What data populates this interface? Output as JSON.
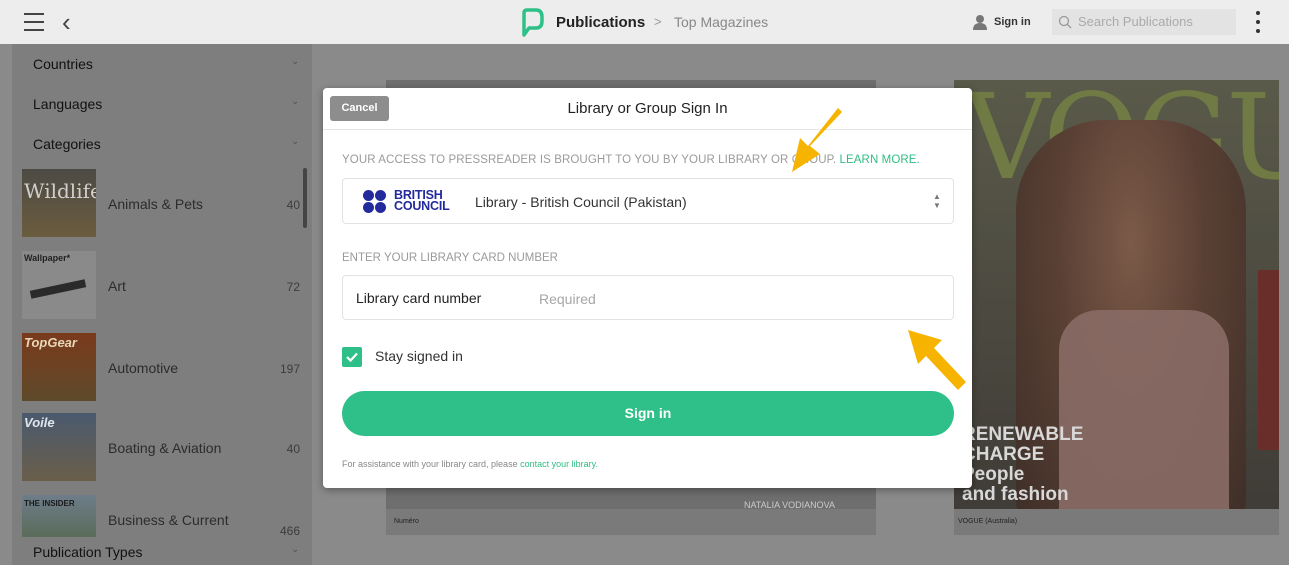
{
  "header": {
    "app_title": "Publications",
    "breadcrumb_sep": ">",
    "breadcrumb": "Top Magazines",
    "sign_in": "Sign in",
    "search_placeholder": "Search Publications"
  },
  "sidebar": {
    "filters": [
      {
        "label": "Countries"
      },
      {
        "label": "Languages"
      },
      {
        "label": "Categories"
      }
    ],
    "categories": [
      {
        "name": "Animals & Pets",
        "count": "40",
        "thumb_text": "Wildlife"
      },
      {
        "name": "Art",
        "count": "72",
        "thumb_text": "Wallpaper*"
      },
      {
        "name": "Automotive",
        "count": "197",
        "thumb_text": "TopGear"
      },
      {
        "name": "Boating & Aviation",
        "count": "40",
        "thumb_text": "Voile"
      },
      {
        "name": "Business & Current",
        "count": "466",
        "thumb_text": "THE INSIDER"
      }
    ],
    "publication_types": "Publication Types"
  },
  "covers": {
    "left_caption": "Numéro",
    "left_credit": "NATALIA VODIANOVA",
    "right_caption": "VOGUE (Australia)",
    "right_masthead": "VOGUE",
    "right_headline": [
      "RENEWABLE",
      "CHARGE",
      "People",
      "and fashion"
    ]
  },
  "modal": {
    "cancel": "Cancel",
    "title": "Library or Group Sign In",
    "access_text": "YOUR ACCESS TO PRESSREADER IS BROUGHT TO YOU BY YOUR LIBRARY OR GROUP.",
    "learn_more": "LEARN MORE.",
    "logo_line1": "BRITISH",
    "logo_line2": "COUNCIL",
    "library_selected": "Library - British Council (Pakistan)",
    "card_section_label": "ENTER YOUR LIBRARY CARD NUMBER",
    "card_field_label": "Library card number",
    "card_placeholder": "Required",
    "card_value": "",
    "stay_signed_in": "Stay signed in",
    "stay_signed_in_checked": true,
    "sign_in_button": "Sign in",
    "assist_text": "For assistance with your library card, please",
    "assist_link": "contact your library."
  },
  "colors": {
    "accent": "#2fc089",
    "brand_blue": "#232A9B",
    "annotation_arrow": "#f6b400"
  }
}
